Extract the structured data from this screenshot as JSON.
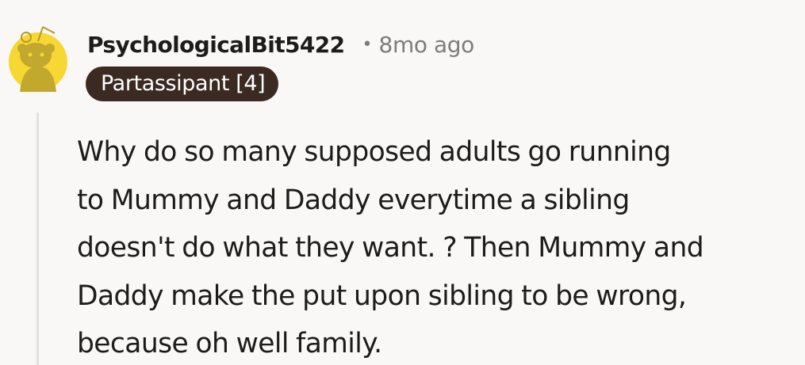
{
  "comment": {
    "author": "PsychologicalBit5422",
    "separator": "•",
    "time": "8mo ago",
    "flair": "Partassipant [4]",
    "avatar": {
      "icon": "snoo-avatar-icon",
      "background_color": "#f7d733"
    },
    "body_lines": [
      "Why do so many supposed adults go running",
      "to Mummy and Daddy everytime a sibling",
      "doesn't do what they want. ? Then Mummy and",
      "Daddy make the put upon sibling to be wrong,",
      "because oh well family."
    ]
  },
  "colors": {
    "background": "#faf8f6",
    "flair_background": "#3a2a22",
    "thread_line": "#e5e0dc",
    "meta_text": "#7c7c7c"
  }
}
